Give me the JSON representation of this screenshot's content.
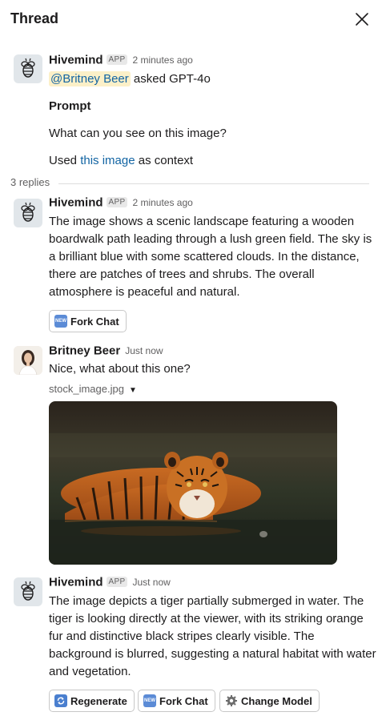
{
  "header": {
    "title": "Thread"
  },
  "original": {
    "sender": "Hivemind",
    "badge": "APP",
    "time": "2 minutes ago",
    "mention": "@Britney Beer",
    "asked": " asked GPT-4o",
    "prompt_label": "Prompt",
    "prompt_text": "What can you see on this image?",
    "used_prefix": "Used ",
    "used_link": "this image",
    "used_suffix": " as context"
  },
  "replies_label": "3 replies",
  "reply1": {
    "sender": "Hivemind",
    "badge": "APP",
    "time": "2 minutes ago",
    "text": "The image shows a scenic landscape featuring a wooden boardwalk path leading through a lush green field. The sky is a brilliant blue with some scattered clouds. In the distance, there are patches of trees and shrubs. The overall atmosphere is peaceful and natural.",
    "fork_label": "Fork Chat"
  },
  "reply2": {
    "sender": "Britney Beer",
    "time": "Just now",
    "text": "Nice, what about this one?",
    "file_name": "stock_image.jpg"
  },
  "reply3": {
    "sender": "Hivemind",
    "badge": "APP",
    "time": "Just now",
    "text": "The image depicts a tiger partially submerged in water. The tiger is looking directly at the viewer, with its striking orange fur and distinctive black stripes clearly visible. The background is blurred, suggesting a natural habitat with water and vegetation.",
    "regenerate_label": "Regenerate",
    "fork_label": "Fork Chat",
    "change_model_label": "Change Model"
  },
  "colors": {
    "link": "#1264a3",
    "mention_bg": "#fcf0c8",
    "muted": "#616061"
  }
}
